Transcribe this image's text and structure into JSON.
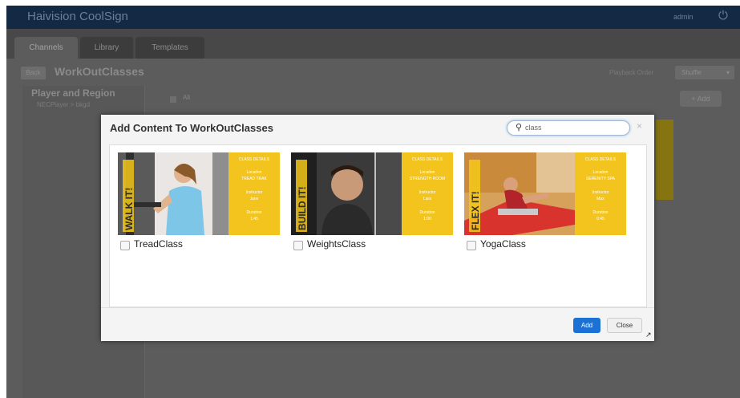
{
  "app": {
    "brand": "Haivision CoolSign",
    "user": "admin"
  },
  "tabs": [
    {
      "label": "Channels"
    },
    {
      "label": "Library"
    },
    {
      "label": "Templates"
    }
  ],
  "header": {
    "back_label": "Back",
    "title": "WorkOutClasses",
    "playback_label": "Playback Order",
    "playback_value": "Shuffle"
  },
  "left_panel": {
    "title": "Player and Region",
    "path": "NECPlayer > bkgd"
  },
  "main": {
    "all_label": "All",
    "add_label": "+ Add"
  },
  "modal": {
    "title": "Add Content To WorkOutClasses",
    "search": {
      "value": "class"
    },
    "items": [
      {
        "name": "TreadClass",
        "banner": "WALK IT!"
      },
      {
        "name": "WeightsClass",
        "banner": "BUILD IT!"
      },
      {
        "name": "YogaClass",
        "banner": "FLEX IT!"
      }
    ],
    "add_button": "Add",
    "close_button": "Close"
  },
  "colors": {
    "topbar": "#142a44",
    "primary": "#1c72d4",
    "thumb_yellow": "#f4c41e"
  },
  "icons": {
    "search": "search-icon",
    "close": "close-icon",
    "power": "power-icon",
    "caret": "caret-down-icon",
    "resize": "resize-handle-icon"
  }
}
